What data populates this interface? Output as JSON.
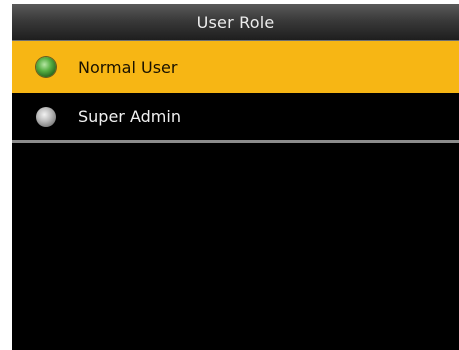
{
  "header": {
    "title": "User Role"
  },
  "menu": {
    "items": [
      {
        "label": "Normal User",
        "selected": true
      },
      {
        "label": "Super Admin",
        "selected": false
      }
    ]
  },
  "colors": {
    "highlight": "#f7b614",
    "background": "#000000",
    "radio_selected": "#58b044",
    "radio_unselected": "#bcbcbc"
  },
  "icons": {
    "selected": "radio-selected-icon",
    "unselected": "radio-unselected-icon"
  }
}
